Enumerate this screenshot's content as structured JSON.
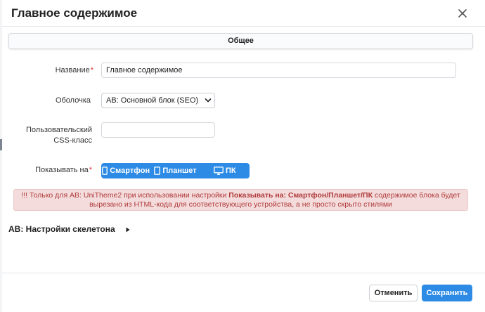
{
  "dialog": {
    "title": "Главное содержимое",
    "close_icon": "close-icon"
  },
  "tabs": [
    {
      "label": "Общее",
      "active": true
    }
  ],
  "form": {
    "name": {
      "label": "Название",
      "required": true,
      "value": "Главное содержимое"
    },
    "wrapper": {
      "label": "Оболочка",
      "selected": "AB: Основной блок (SEO)"
    },
    "css_class": {
      "label": "Пользовательский CSS-класс",
      "value": ""
    },
    "show_on": {
      "label": "Показывать на",
      "required": true,
      "options": [
        {
          "label": "Смартфон",
          "icon": "smartphone-icon"
        },
        {
          "label": "Планшет",
          "icon": "tablet-icon"
        },
        {
          "label": "ПК",
          "icon": "desktop-icon"
        }
      ]
    }
  },
  "alert": {
    "prefix": "!!! Только для AB: UniTheme2 при использовании настройки ",
    "emphasis": "Показывать на: Смартфон/Планшет/ПК",
    "suffix": " содержимое блока будет вырезано из HTML-кода для соответствующего устройства, а не просто скрыто стилями"
  },
  "skeleton_section": {
    "label": "AB: Настройки скелетона",
    "icon": "caret-right-icon"
  },
  "footer": {
    "cancel_label": "Отменить",
    "save_label": "Сохранить"
  },
  "colors": {
    "accent": "#2d8be6",
    "alert_bg": "#f4dcdc",
    "alert_text": "#b03a3a",
    "required": "#e03030"
  }
}
